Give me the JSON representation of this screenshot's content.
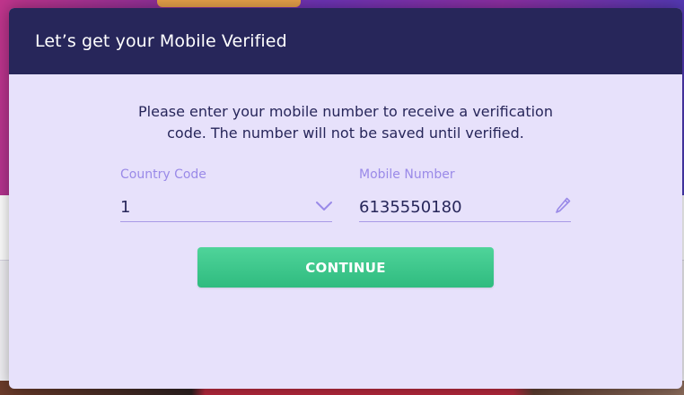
{
  "modal": {
    "title": "Let’s get your Mobile Verified",
    "instructions": {
      "line1": "Please enter your mobile number to receive a verification",
      "line2": "code. The number will not be saved until verified."
    },
    "country_code": {
      "label": "Country Code",
      "value": "1",
      "icon": "chevron-down-icon"
    },
    "mobile_number": {
      "label": "Mobile Number",
      "value": "6135550180",
      "icon": "pencil-icon"
    },
    "continue_label": "CONTINUE"
  },
  "colors": {
    "header_bg": "#27265a",
    "body_bg": "#e7e1fb",
    "label": "#9a8ae8",
    "text": "#27265a",
    "button": "#3cc68b"
  }
}
